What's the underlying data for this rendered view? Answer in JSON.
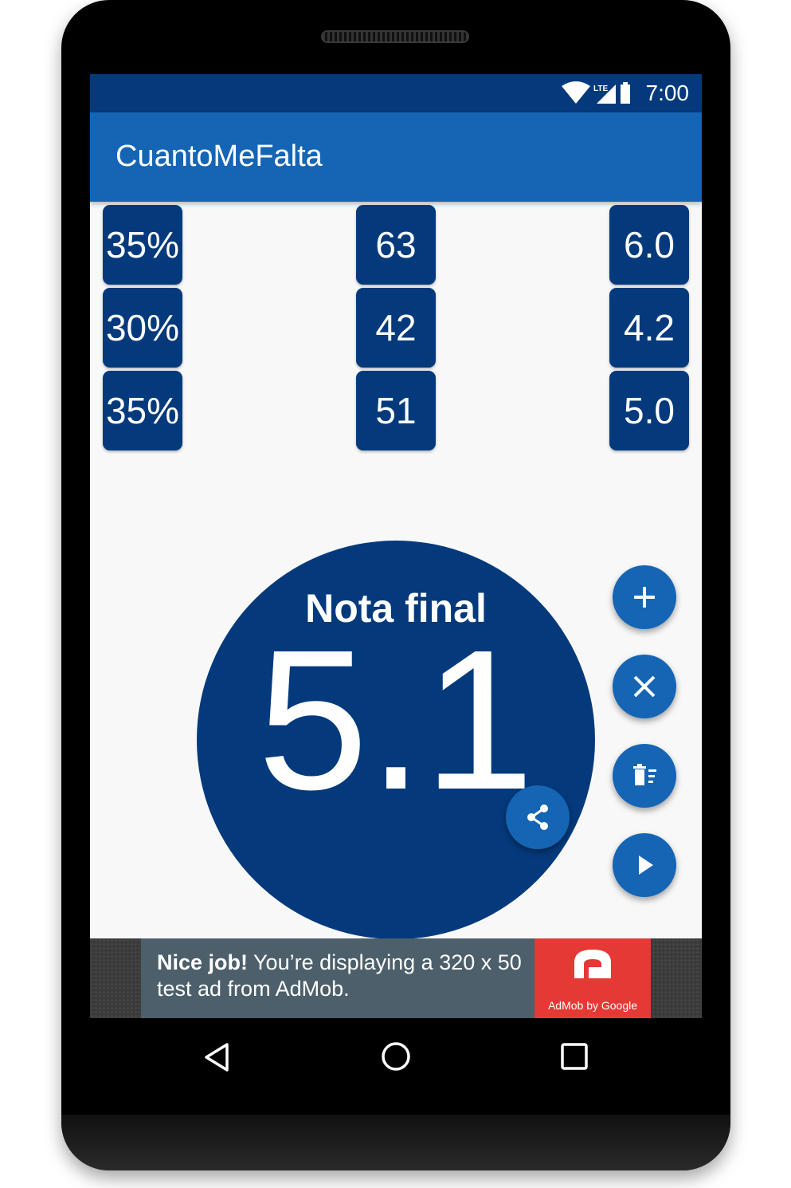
{
  "status_bar": {
    "time": "7:00",
    "network": "LTE",
    "icons": [
      "wifi-icon",
      "signal-icon",
      "battery-icon"
    ]
  },
  "app_bar": {
    "title": "CuantoMeFalta"
  },
  "grades": [
    {
      "weight": "35%",
      "score": "63",
      "grade": "6.0"
    },
    {
      "weight": "30%",
      "score": "42",
      "grade": "4.2"
    },
    {
      "weight": "35%",
      "score": "51",
      "grade": "5.0"
    }
  ],
  "result": {
    "label": "Nota final",
    "value": "5.1"
  },
  "fabs": [
    "share-icon",
    "add-icon",
    "close-icon",
    "clear-list-icon",
    "play-icon"
  ],
  "ad": {
    "bold": "Nice job!",
    "text": " You’re displaying a 320 x 50 test ad from AdMob.",
    "logo_caption": "AdMob by Google"
  },
  "nav": [
    "back-icon",
    "home-icon",
    "recents-icon"
  ],
  "colors": {
    "primary_dark": "#043a7c",
    "primary": "#1565b4",
    "background": "#f8f8f8",
    "ad_red": "#e53935"
  }
}
